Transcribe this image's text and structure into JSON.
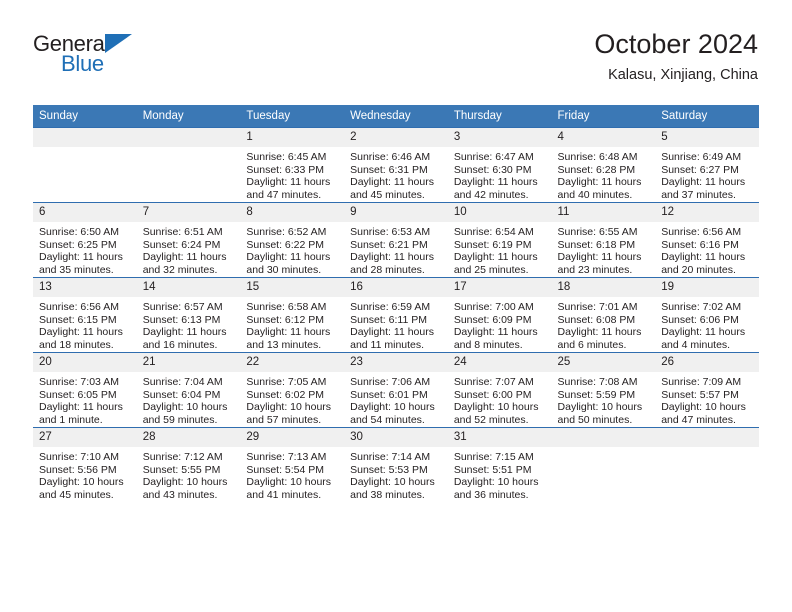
{
  "brand": {
    "name_top": "General",
    "name_bottom": "Blue",
    "accent_color": "#1f6fb6"
  },
  "header": {
    "month_title": "October 2024",
    "location": "Kalasu, Xinjiang, China"
  },
  "calendar": {
    "header_color": "#3b78b5",
    "daynum_band_color": "#f0f0f0",
    "row_divider_color": "#2f6daf",
    "weekday_headers": [
      "Sunday",
      "Monday",
      "Tuesday",
      "Wednesday",
      "Thursday",
      "Friday",
      "Saturday"
    ],
    "weeks": [
      [
        {
          "day": "",
          "lines": []
        },
        {
          "day": "",
          "lines": []
        },
        {
          "day": "1",
          "lines": [
            "Sunrise: 6:45 AM",
            "Sunset: 6:33 PM",
            "Daylight: 11 hours",
            "and 47 minutes."
          ]
        },
        {
          "day": "2",
          "lines": [
            "Sunrise: 6:46 AM",
            "Sunset: 6:31 PM",
            "Daylight: 11 hours",
            "and 45 minutes."
          ]
        },
        {
          "day": "3",
          "lines": [
            "Sunrise: 6:47 AM",
            "Sunset: 6:30 PM",
            "Daylight: 11 hours",
            "and 42 minutes."
          ]
        },
        {
          "day": "4",
          "lines": [
            "Sunrise: 6:48 AM",
            "Sunset: 6:28 PM",
            "Daylight: 11 hours",
            "and 40 minutes."
          ]
        },
        {
          "day": "5",
          "lines": [
            "Sunrise: 6:49 AM",
            "Sunset: 6:27 PM",
            "Daylight: 11 hours",
            "and 37 minutes."
          ]
        }
      ],
      [
        {
          "day": "6",
          "lines": [
            "Sunrise: 6:50 AM",
            "Sunset: 6:25 PM",
            "Daylight: 11 hours",
            "and 35 minutes."
          ]
        },
        {
          "day": "7",
          "lines": [
            "Sunrise: 6:51 AM",
            "Sunset: 6:24 PM",
            "Daylight: 11 hours",
            "and 32 minutes."
          ]
        },
        {
          "day": "8",
          "lines": [
            "Sunrise: 6:52 AM",
            "Sunset: 6:22 PM",
            "Daylight: 11 hours",
            "and 30 minutes."
          ]
        },
        {
          "day": "9",
          "lines": [
            "Sunrise: 6:53 AM",
            "Sunset: 6:21 PM",
            "Daylight: 11 hours",
            "and 28 minutes."
          ]
        },
        {
          "day": "10",
          "lines": [
            "Sunrise: 6:54 AM",
            "Sunset: 6:19 PM",
            "Daylight: 11 hours",
            "and 25 minutes."
          ]
        },
        {
          "day": "11",
          "lines": [
            "Sunrise: 6:55 AM",
            "Sunset: 6:18 PM",
            "Daylight: 11 hours",
            "and 23 minutes."
          ]
        },
        {
          "day": "12",
          "lines": [
            "Sunrise: 6:56 AM",
            "Sunset: 6:16 PM",
            "Daylight: 11 hours",
            "and 20 minutes."
          ]
        }
      ],
      [
        {
          "day": "13",
          "lines": [
            "Sunrise: 6:56 AM",
            "Sunset: 6:15 PM",
            "Daylight: 11 hours",
            "and 18 minutes."
          ]
        },
        {
          "day": "14",
          "lines": [
            "Sunrise: 6:57 AM",
            "Sunset: 6:13 PM",
            "Daylight: 11 hours",
            "and 16 minutes."
          ]
        },
        {
          "day": "15",
          "lines": [
            "Sunrise: 6:58 AM",
            "Sunset: 6:12 PM",
            "Daylight: 11 hours",
            "and 13 minutes."
          ]
        },
        {
          "day": "16",
          "lines": [
            "Sunrise: 6:59 AM",
            "Sunset: 6:11 PM",
            "Daylight: 11 hours",
            "and 11 minutes."
          ]
        },
        {
          "day": "17",
          "lines": [
            "Sunrise: 7:00 AM",
            "Sunset: 6:09 PM",
            "Daylight: 11 hours",
            "and 8 minutes."
          ]
        },
        {
          "day": "18",
          "lines": [
            "Sunrise: 7:01 AM",
            "Sunset: 6:08 PM",
            "Daylight: 11 hours",
            "and 6 minutes."
          ]
        },
        {
          "day": "19",
          "lines": [
            "Sunrise: 7:02 AM",
            "Sunset: 6:06 PM",
            "Daylight: 11 hours",
            "and 4 minutes."
          ]
        }
      ],
      [
        {
          "day": "20",
          "lines": [
            "Sunrise: 7:03 AM",
            "Sunset: 6:05 PM",
            "Daylight: 11 hours",
            "and 1 minute."
          ]
        },
        {
          "day": "21",
          "lines": [
            "Sunrise: 7:04 AM",
            "Sunset: 6:04 PM",
            "Daylight: 10 hours",
            "and 59 minutes."
          ]
        },
        {
          "day": "22",
          "lines": [
            "Sunrise: 7:05 AM",
            "Sunset: 6:02 PM",
            "Daylight: 10 hours",
            "and 57 minutes."
          ]
        },
        {
          "day": "23",
          "lines": [
            "Sunrise: 7:06 AM",
            "Sunset: 6:01 PM",
            "Daylight: 10 hours",
            "and 54 minutes."
          ]
        },
        {
          "day": "24",
          "lines": [
            "Sunrise: 7:07 AM",
            "Sunset: 6:00 PM",
            "Daylight: 10 hours",
            "and 52 minutes."
          ]
        },
        {
          "day": "25",
          "lines": [
            "Sunrise: 7:08 AM",
            "Sunset: 5:59 PM",
            "Daylight: 10 hours",
            "and 50 minutes."
          ]
        },
        {
          "day": "26",
          "lines": [
            "Sunrise: 7:09 AM",
            "Sunset: 5:57 PM",
            "Daylight: 10 hours",
            "and 47 minutes."
          ]
        }
      ],
      [
        {
          "day": "27",
          "lines": [
            "Sunrise: 7:10 AM",
            "Sunset: 5:56 PM",
            "Daylight: 10 hours",
            "and 45 minutes."
          ]
        },
        {
          "day": "28",
          "lines": [
            "Sunrise: 7:12 AM",
            "Sunset: 5:55 PM",
            "Daylight: 10 hours",
            "and 43 minutes."
          ]
        },
        {
          "day": "29",
          "lines": [
            "Sunrise: 7:13 AM",
            "Sunset: 5:54 PM",
            "Daylight: 10 hours",
            "and 41 minutes."
          ]
        },
        {
          "day": "30",
          "lines": [
            "Sunrise: 7:14 AM",
            "Sunset: 5:53 PM",
            "Daylight: 10 hours",
            "and 38 minutes."
          ]
        },
        {
          "day": "31",
          "lines": [
            "Sunrise: 7:15 AM",
            "Sunset: 5:51 PM",
            "Daylight: 10 hours",
            "and 36 minutes."
          ]
        },
        {
          "day": "",
          "lines": []
        },
        {
          "day": "",
          "lines": []
        }
      ]
    ]
  }
}
